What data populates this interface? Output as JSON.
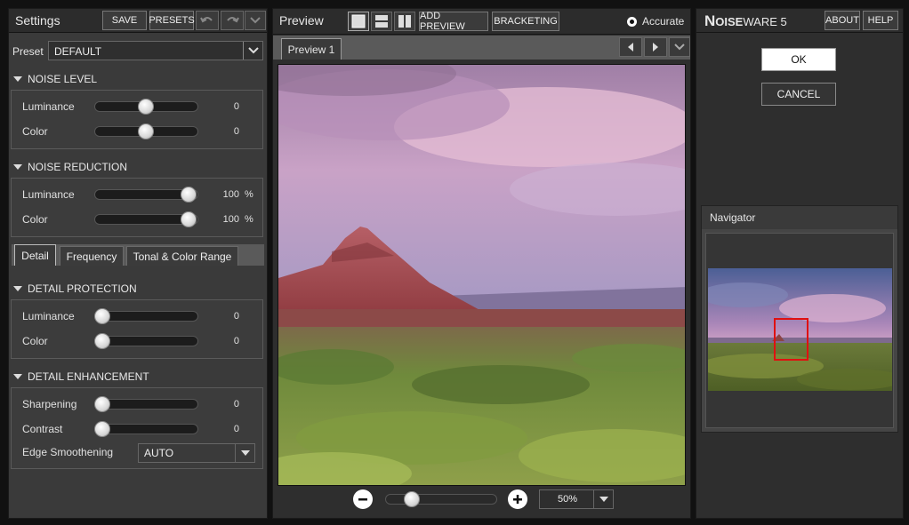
{
  "settings": {
    "title": "Settings",
    "save_label": "SAVE",
    "presets_label": "PRESETS",
    "preset_label": "Preset",
    "preset_value": "DEFAULT",
    "noise_level": {
      "title": "NOISE LEVEL",
      "rows": [
        {
          "label": "Luminance",
          "value": "0",
          "level": 0.5
        },
        {
          "label": "Color",
          "value": "0",
          "level": 0.5
        }
      ]
    },
    "noise_reduction": {
      "title": "NOISE REDUCTION",
      "rows": [
        {
          "label": "Luminance",
          "value": "100",
          "unit": "%",
          "level": 1.0
        },
        {
          "label": "Color",
          "value": "100",
          "unit": "%",
          "level": 1.0
        }
      ]
    },
    "tabs": [
      "Detail",
      "Frequency",
      "Tonal & Color Range"
    ],
    "active_tab": "Detail",
    "detail_protection": {
      "title": "DETAIL PROTECTION",
      "rows": [
        {
          "label": "Luminance",
          "value": "0",
          "level": 0.0
        },
        {
          "label": "Color",
          "value": "0",
          "level": 0.0
        }
      ]
    },
    "detail_enhancement": {
      "title": "DETAIL ENHANCEMENT",
      "rows": [
        {
          "label": "Sharpening",
          "value": "0",
          "level": 0.0
        },
        {
          "label": "Contrast",
          "value": "0",
          "level": 0.0
        }
      ],
      "edge_smoothing_label": "Edge Smoothening",
      "edge_smoothing_value": "AUTO"
    }
  },
  "preview": {
    "title": "Preview",
    "add_preview_label": "ADD PREVIEW",
    "bracketing_label": "BRACKETING",
    "accurate_label": "Accurate",
    "tab_label": "Preview 1",
    "zoom_value": "50%",
    "zoom_level": 0.2
  },
  "right": {
    "brand_big": "N",
    "brand_rest": "OISE",
    "brand_ware": "WARE 5",
    "about_label": "ABOUT",
    "help_label": "HELP",
    "ok_label": "OK",
    "cancel_label": "CANCEL",
    "navigator_title": "Navigator"
  },
  "colors": {
    "panel_bg": "#3a3a3a",
    "header_bg": "#2c2c2c",
    "nav_box": "#e01010"
  }
}
